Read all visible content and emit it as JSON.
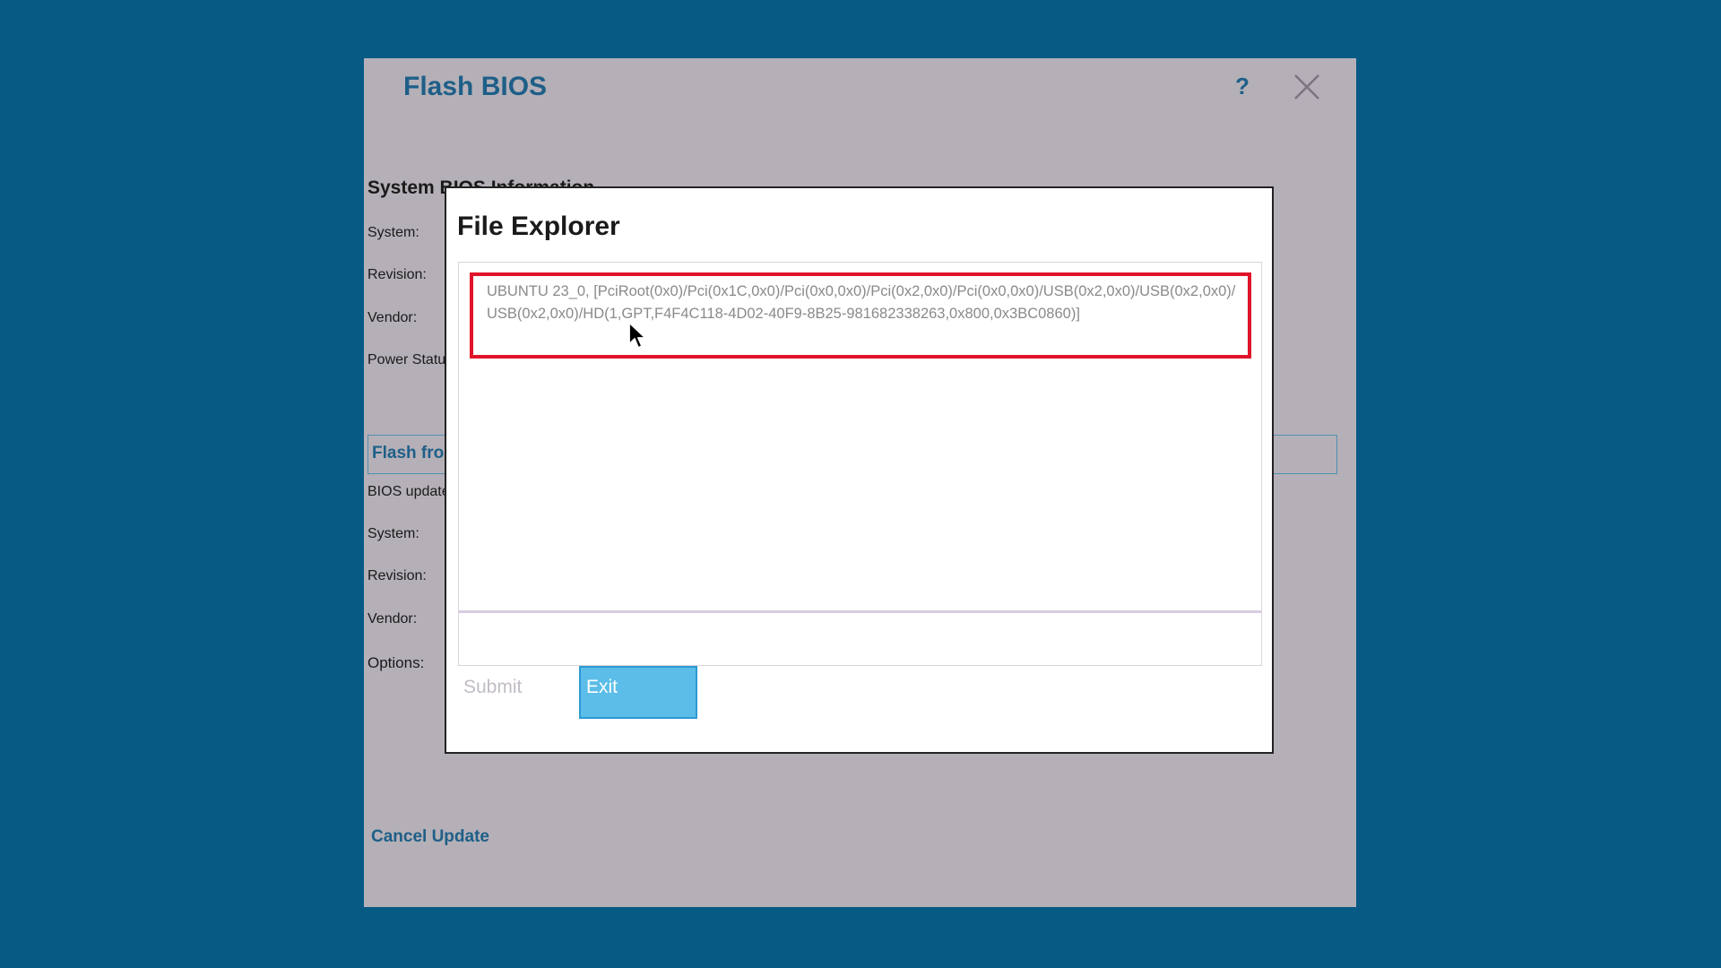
{
  "window": {
    "title": "Flash BIOS",
    "help_label": "?",
    "section_title": "System BIOS Information",
    "labels": {
      "system": "System:",
      "revision": "Revision:",
      "vendor": "Vendor:",
      "power_status": "Power Status:",
      "flash_from": "Flash from",
      "bios_update": "BIOS update",
      "system2": "System:",
      "revision2": "Revision:",
      "vendor2": "Vendor:",
      "options": "Options:"
    },
    "cancel_update": "Cancel Update"
  },
  "dialog": {
    "title": "File Explorer",
    "items": [
      {
        "text": "UBUNTU 23_0, [PciRoot(0x0)/Pci(0x1C,0x0)/Pci(0x0,0x0)/Pci(0x2,0x0)/Pci(0x0,0x0)/USB(0x2,0x0)/USB(0x2,0x0)/USB(0x2,0x0)/HD(1,GPT,F4F4C118-4D02-40F9-8B25-981682338263,0x800,0x3BC0860)]"
      }
    ],
    "path_value": "",
    "submit_label": "Submit",
    "exit_label": "Exit"
  },
  "colors": {
    "desktop": "#075a84",
    "window_bg": "#b5b0b7",
    "accent": "#1e5f88",
    "selection_border": "#e0142a",
    "exit_button": "#5bbde8"
  }
}
